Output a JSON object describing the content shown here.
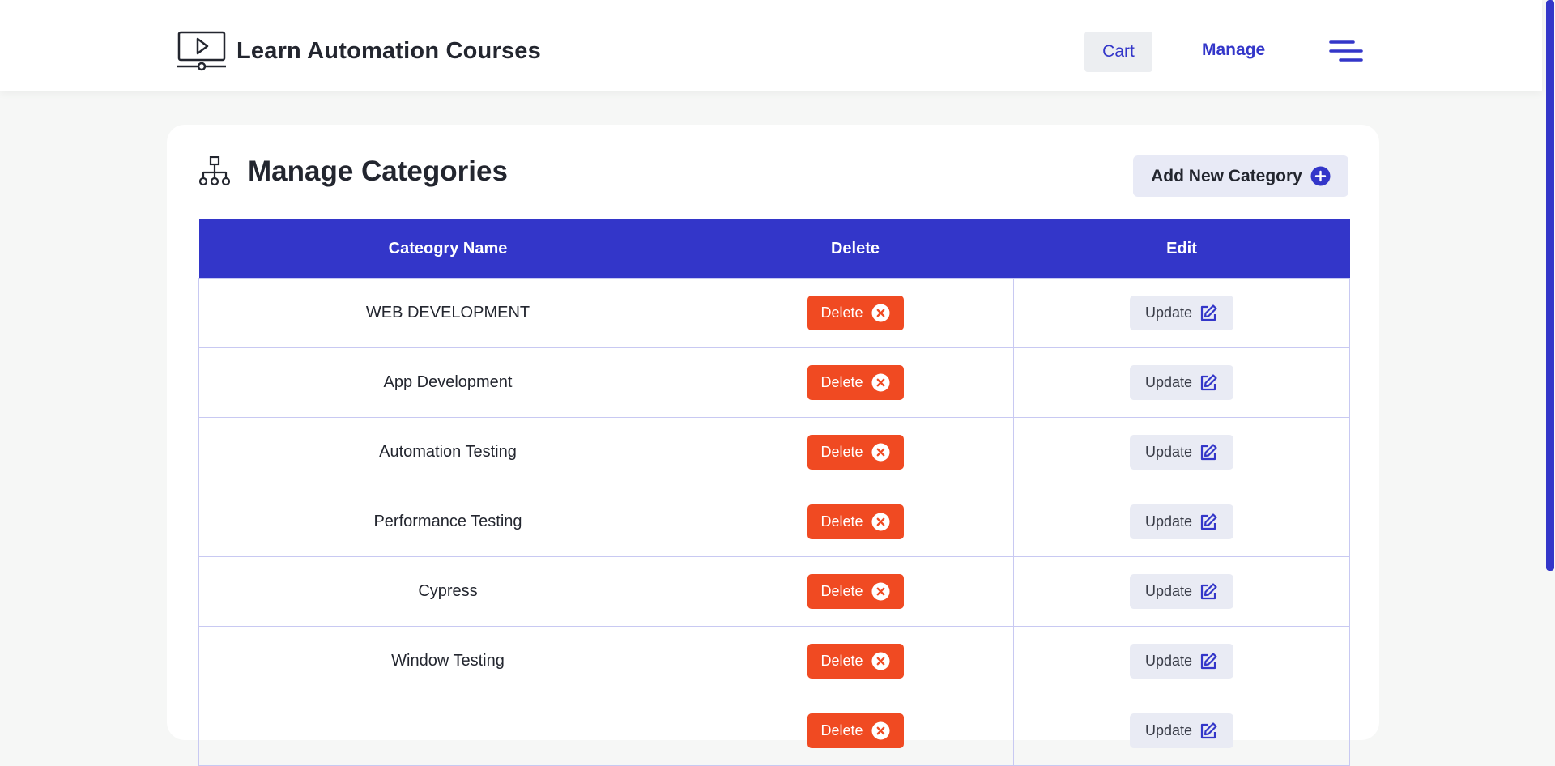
{
  "header": {
    "brand_title": "Learn Automation Courses",
    "cart_label": "Cart",
    "manage_label": "Manage"
  },
  "page": {
    "title": "Manage Categories",
    "add_button_label": "Add New Category"
  },
  "table": {
    "headers": [
      "Cateogry Name",
      "Delete",
      "Edit"
    ],
    "rows": [
      {
        "name": "WEB DEVELOPMENT",
        "delete_label": "Delete",
        "update_label": "Update"
      },
      {
        "name": "App Development",
        "delete_label": "Delete",
        "update_label": "Update"
      },
      {
        "name": "Automation Testing",
        "delete_label": "Delete",
        "update_label": "Update"
      },
      {
        "name": "Performance Testing",
        "delete_label": "Delete",
        "update_label": "Update"
      },
      {
        "name": "Cypress",
        "delete_label": "Delete",
        "update_label": "Update"
      },
      {
        "name": "Window Testing",
        "delete_label": "Delete",
        "update_label": "Update"
      },
      {
        "name": "",
        "delete_label": "Delete",
        "update_label": "Update"
      }
    ]
  },
  "icons": {
    "brand": "video-player-icon",
    "menu": "hamburger-menu-icon",
    "page": "sitemap-icon",
    "add": "plus-circle-icon",
    "delete": "close-circle-icon",
    "update": "edit-icon"
  },
  "colors": {
    "accent": "#3336c9",
    "danger": "#f04a22",
    "page_bg": "#f6f7f6"
  }
}
